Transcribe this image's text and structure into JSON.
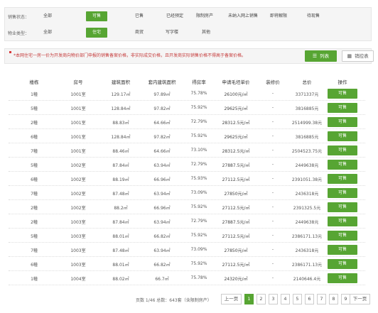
{
  "filters": {
    "sale_status": {
      "label": "销售状态：",
      "options": [
        "全部",
        "可售",
        "已售",
        "已经预定",
        "限制房产",
        "未纳入网上销售",
        "即将解限",
        "待现售"
      ],
      "selected": "可售"
    },
    "property_type": {
      "label": "物业类型：",
      "options": [
        "全部",
        "住宅",
        "商贸",
        "写字楼",
        "其他"
      ],
      "selected": "住宅"
    }
  },
  "notice": {
    "text": "*本网住宅一房一价为开发商向物价部门申报的销售备案价格，非实际成交价格，且开发商实际销售价格不得高于备案价格。",
    "list_button": "列表",
    "control_button": "销控表",
    "list_icon": "list-icon",
    "control_icon": "grid-icon"
  },
  "table": {
    "headers": [
      "楼栋",
      "房号",
      "建筑面积",
      "套内建筑面积",
      "得房率",
      "申请毛坯单价",
      "装修价",
      "总价",
      "操作"
    ],
    "rows": [
      {
        "building": "1幢",
        "room": "1001室",
        "area": "129.17㎡",
        "inner_area": "97.89㎡",
        "ratio": "75.78%",
        "unit_price": "26100元/㎡",
        "decoration": "-",
        "total": "3371337元",
        "action": "可售"
      },
      {
        "building": "5幢",
        "room": "1001室",
        "area": "128.84㎡",
        "inner_area": "97.82㎡",
        "ratio": "75.92%",
        "unit_price": "29625元/㎡",
        "decoration": "-",
        "total": "3816885元",
        "action": "可售"
      },
      {
        "building": "2幢",
        "room": "1001室",
        "area": "88.83㎡",
        "inner_area": "64.66㎡",
        "ratio": "72.79%",
        "unit_price": "28312.5元/㎡",
        "decoration": "-",
        "total": "2514999.38元",
        "action": "可售"
      },
      {
        "building": "6幢",
        "room": "1001室",
        "area": "128.84㎡",
        "inner_area": "97.82㎡",
        "ratio": "75.92%",
        "unit_price": "29625元/㎡",
        "decoration": "-",
        "total": "3816885元",
        "action": "可售"
      },
      {
        "building": "7幢",
        "room": "1001室",
        "area": "88.46㎡",
        "inner_area": "64.66㎡",
        "ratio": "73.10%",
        "unit_price": "28312.5元/㎡",
        "decoration": "-",
        "total": "2504523.75元",
        "action": "可售"
      },
      {
        "building": "5幢",
        "room": "1002室",
        "area": "87.84㎡",
        "inner_area": "63.94㎡",
        "ratio": "72.79%",
        "unit_price": "27887.5元/㎡",
        "decoration": "-",
        "total": "2449638元",
        "action": "可售"
      },
      {
        "building": "6幢",
        "room": "1002室",
        "area": "88.19㎡",
        "inner_area": "66.96㎡",
        "ratio": "75.93%",
        "unit_price": "27112.5元/㎡",
        "decoration": "-",
        "total": "2391051.38元",
        "action": "可售"
      },
      {
        "building": "7幢",
        "room": "1002室",
        "area": "87.48㎡",
        "inner_area": "63.94㎡",
        "ratio": "73.09%",
        "unit_price": "27850元/㎡",
        "decoration": "-",
        "total": "2436318元",
        "action": "可售"
      },
      {
        "building": "2幢",
        "room": "1002室",
        "area": "88.2㎡",
        "inner_area": "66.96㎡",
        "ratio": "75.92%",
        "unit_price": "27112.5元/㎡",
        "decoration": "-",
        "total": "2391325.5元",
        "action": "可售"
      },
      {
        "building": "2幢",
        "room": "1003室",
        "area": "87.84㎡",
        "inner_area": "63.94㎡",
        "ratio": "72.79%",
        "unit_price": "27887.5元/㎡",
        "decoration": "-",
        "total": "2449638元",
        "action": "可售"
      },
      {
        "building": "5幢",
        "room": "1003室",
        "area": "88.01㎡",
        "inner_area": "66.82㎡",
        "ratio": "75.92%",
        "unit_price": "27112.5元/㎡",
        "decoration": "-",
        "total": "2386171.13元",
        "action": "可售"
      },
      {
        "building": "7幢",
        "room": "1003室",
        "area": "87.48㎡",
        "inner_area": "63.94㎡",
        "ratio": "73.09%",
        "unit_price": "27850元/㎡",
        "decoration": "-",
        "total": "2436318元",
        "action": "可售"
      },
      {
        "building": "6幢",
        "room": "1003室",
        "area": "88.01㎡",
        "inner_area": "66.82㎡",
        "ratio": "75.92%",
        "unit_price": "27112.5元/㎡",
        "decoration": "-",
        "total": "2386171.13元",
        "action": "可售"
      },
      {
        "building": "1幢",
        "room": "1004室",
        "area": "88.02㎡",
        "inner_area": "66.7㎡",
        "ratio": "75.78%",
        "unit_price": "24320元/㎡",
        "decoration": "-",
        "total": "2140646.4元",
        "action": "可售"
      }
    ]
  },
  "pagination": {
    "info": "页数 1/46 总数：643套（含限制房产）",
    "prev": "上一页",
    "pages": [
      "1",
      "2",
      "3",
      "4",
      "5",
      "6",
      "7",
      "8",
      "9"
    ],
    "current": "1",
    "next": "下一页"
  },
  "colors": {
    "accent_green": "#57a533",
    "notice_red": "#c53b3b"
  }
}
